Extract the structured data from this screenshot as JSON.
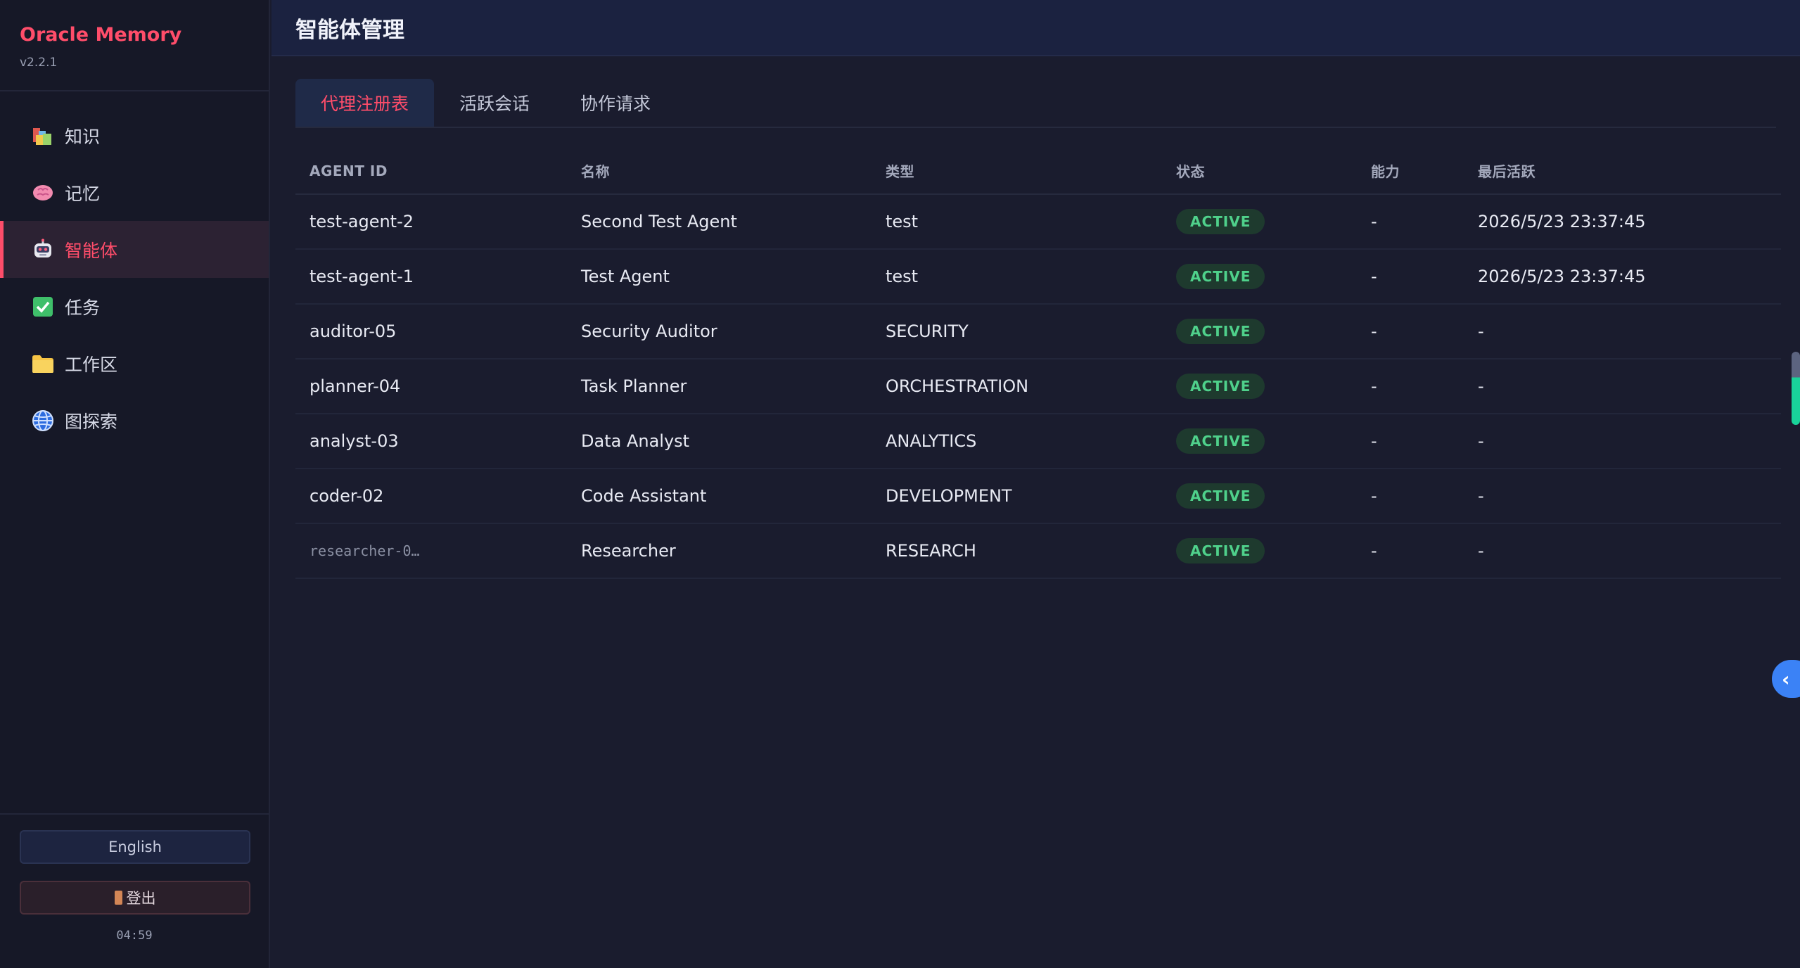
{
  "sidebar": {
    "brand_title": "Oracle Memory",
    "version": "v2.2.1",
    "items": [
      {
        "label": "知识",
        "icon": "books-icon"
      },
      {
        "label": "记忆",
        "icon": "brain-icon"
      },
      {
        "label": "智能体",
        "icon": "robot-icon",
        "active": true
      },
      {
        "label": "任务",
        "icon": "checkbox-icon"
      },
      {
        "label": "工作区",
        "icon": "folder-icon"
      },
      {
        "label": "图探索",
        "icon": "globe-icon"
      }
    ],
    "language_button": "English",
    "logout_button": "登出",
    "clock": "04:59"
  },
  "header": {
    "title": "智能体管理"
  },
  "tabs": [
    {
      "label": "代理注册表",
      "active": true
    },
    {
      "label": "活跃会话"
    },
    {
      "label": "协作请求"
    }
  ],
  "table": {
    "headers": [
      "AGENT ID",
      "名称",
      "类型",
      "状态",
      "能力",
      "最后活跃"
    ],
    "rows": [
      {
        "id": "test-agent-2",
        "name": "Second Test Agent",
        "type": "test",
        "status": "ACTIVE",
        "capability": "-",
        "last_active": "2026/5/23 23:37:45"
      },
      {
        "id": "test-agent-1",
        "name": "Test Agent",
        "type": "test",
        "status": "ACTIVE",
        "capability": "-",
        "last_active": "2026/5/23 23:37:45"
      },
      {
        "id": "auditor-05",
        "name": "Security Auditor",
        "type": "SECURITY",
        "status": "ACTIVE",
        "capability": "-",
        "last_active": "-"
      },
      {
        "id": "planner-04",
        "name": "Task Planner",
        "type": "ORCHESTRATION",
        "status": "ACTIVE",
        "capability": "-",
        "last_active": "-"
      },
      {
        "id": "analyst-03",
        "name": "Data Analyst",
        "type": "ANALYTICS",
        "status": "ACTIVE",
        "capability": "-",
        "last_active": "-"
      },
      {
        "id": "coder-02",
        "name": "Code Assistant",
        "type": "DEVELOPMENT",
        "status": "ACTIVE",
        "capability": "-",
        "last_active": "-"
      },
      {
        "id": "researcher-0…",
        "name": "Researcher",
        "type": "RESEARCH",
        "status": "ACTIVE",
        "capability": "-",
        "last_active": "-"
      }
    ]
  },
  "colors": {
    "accent": "#ff4d6a",
    "active_status": "#4fd18b",
    "collapse_button": "#3b82f6"
  },
  "collapse_button_icon": "chevron-left-icon"
}
